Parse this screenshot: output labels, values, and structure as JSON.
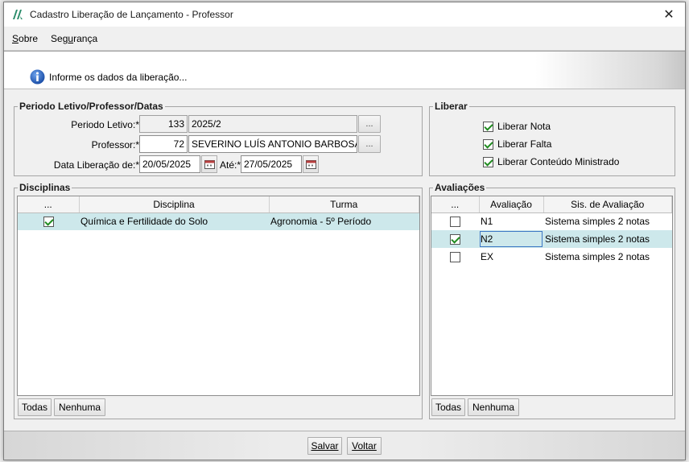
{
  "window": {
    "title": "Cadastro Liberação de Lançamento - Professor",
    "close_glyph": "✕"
  },
  "menu": {
    "items": [
      {
        "label": "Sobre"
      },
      {
        "label": "Segurança"
      }
    ]
  },
  "banner": {
    "icon": "info-icon",
    "text": "Informe os dados da liberação..."
  },
  "periodo": {
    "legend": "Periodo Letivo/Professor/Datas",
    "periodo_label": "Periodo Letivo:*",
    "periodo_code": "133",
    "periodo_name": "2025/2",
    "professor_label": "Professor:*",
    "professor_code": "72",
    "professor_name": "SEVERINO LUÍS ANTONIO BARBOSA",
    "lookup_label": "...",
    "data_label": "Data Liberação de:*",
    "data_de": "20/05/2025",
    "ate_label": "Até:*",
    "data_ate": "27/05/2025"
  },
  "liberar": {
    "legend": "Liberar",
    "options": [
      {
        "label": "Liberar Nota",
        "checked": true
      },
      {
        "label": "Liberar Falta",
        "checked": true
      },
      {
        "label": "Liberar Conteúdo Ministrado",
        "checked": true
      }
    ]
  },
  "disciplinas": {
    "legend": "Disciplinas",
    "columns": [
      "...",
      "Disciplina",
      "Turma"
    ],
    "rows": [
      {
        "checked": true,
        "disciplina": "Química e Fertilidade do Solo",
        "turma": "Agronomia - 5º Período"
      }
    ],
    "todas_label": "Todas",
    "nenhuma_label": "Nenhuma"
  },
  "avaliacoes": {
    "legend": "Avaliações",
    "columns": [
      "...",
      "Avaliação",
      "Sis. de Avaliação"
    ],
    "rows": [
      {
        "checked": false,
        "avaliacao": "N1",
        "sistema": "Sistema simples 2 notas"
      },
      {
        "checked": true,
        "avaliacao": "N2",
        "sistema": "Sistema simples 2 notas"
      },
      {
        "checked": false,
        "avaliacao": "EX",
        "sistema": "Sistema simples 2 notas"
      }
    ],
    "todas_label": "Todas",
    "nenhuma_label": "Nenhuma"
  },
  "footer": {
    "salvar_label": "Salvar",
    "voltar_label": "Voltar"
  },
  "colors": {
    "selected_row": "#cde8eb",
    "check_mark": "#1f8b1f",
    "info_blue": "#1f5fbf"
  }
}
